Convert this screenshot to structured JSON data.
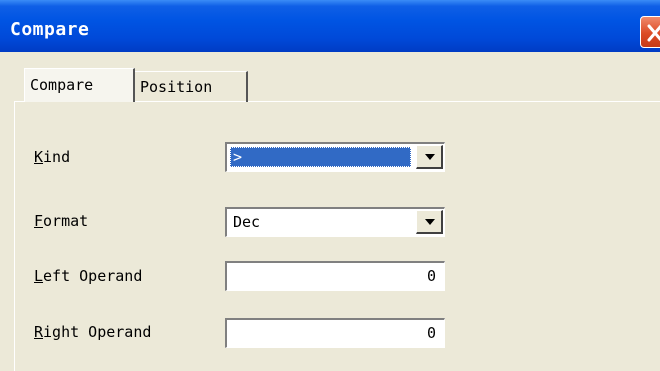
{
  "window": {
    "title": "Compare"
  },
  "tabs": [
    {
      "label": "Compare",
      "active": true
    },
    {
      "label": "Position",
      "active": false
    }
  ],
  "form": {
    "kind": {
      "label_accel": "K",
      "label_rest": "ind",
      "value": ">",
      "selected": true
    },
    "format": {
      "label_accel": "F",
      "label_rest": "ormat",
      "value": "Dec"
    },
    "left_operand": {
      "label_accel": "L",
      "label_rest": "eft Operand",
      "value": "0"
    },
    "right_operand": {
      "label_accel": "R",
      "label_rest": "ight Operand",
      "value": "0"
    }
  },
  "colors": {
    "titlebar": "#0054e3",
    "selection": "#316ac5",
    "close_button": "#dc4b25",
    "dialog_bg": "#ece9d8"
  },
  "icons": {
    "close": "close-icon",
    "dropdown": "chevron-down-icon"
  }
}
